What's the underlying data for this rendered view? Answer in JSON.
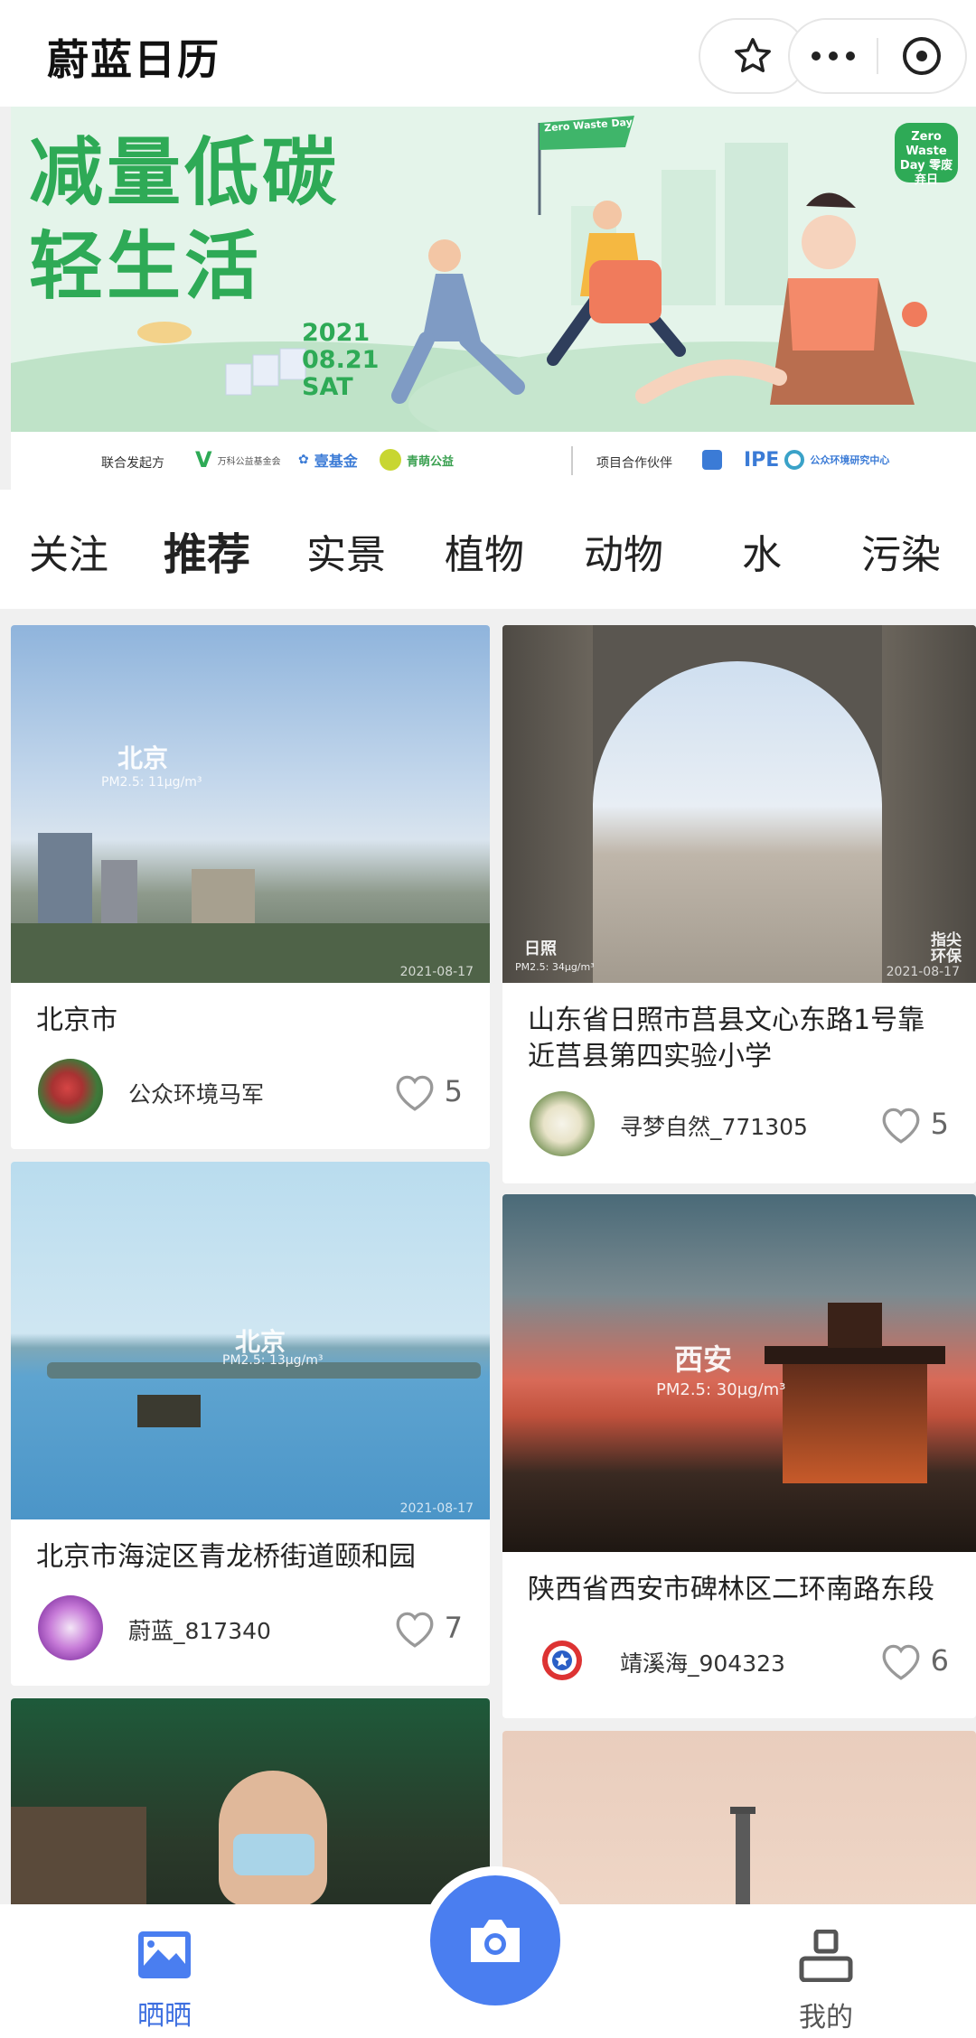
{
  "app": {
    "title": "蔚蓝日历"
  },
  "banner": {
    "title_line1": "减量低碳",
    "title_line2": "轻生活",
    "date_year": "2021",
    "date_md": "08.21",
    "date_day": "SAT",
    "zero_badge": "Zero Waste Day 零废弃日",
    "flag_text": "Zero Waste Day",
    "co_initiators_label": "联合发起方",
    "partner_1": "万科公益基金会",
    "partner_2": "壹基金",
    "partner_3": "青萌公益",
    "project_partner_label": "项目合作伙伴",
    "partner_4": "IPE",
    "partner_5": "公众环境研究中心"
  },
  "tabs": [
    "关注",
    "推荐",
    "实景",
    "植物",
    "动物",
    "水",
    "污染"
  ],
  "active_tab": "推荐",
  "cards": [
    {
      "place": "北京市",
      "user": "公众环境马军",
      "likes": "5",
      "city_overlay": "北京",
      "pm": "PM2.5: 11μg/m³",
      "photo_date": "2021-08-17"
    },
    {
      "place": "山东省日照市莒县文心东路1号靠近莒县第四实验小学",
      "user": "寻梦自然_771305",
      "likes": "5",
      "city_overlay": "日照",
      "pm": "PM2.5: 34μg/m³",
      "photo_date": "2021-08-17",
      "corner_text": "指尖环保"
    },
    {
      "place": "北京市海淀区青龙桥街道颐和园",
      "user": "蔚蓝_817340",
      "likes": "7",
      "city_overlay": "北京",
      "pm": "PM2.5: 13μg/m³",
      "photo_date": "2021-08-17"
    },
    {
      "place": "陕西省西安市碑林区二环南路东段",
      "user": "靖溪海_904323",
      "likes": "6",
      "city_overlay": "西安",
      "pm": "PM2.5:  30μg/m³"
    }
  ],
  "nav": {
    "left": "晒晒",
    "right": "我的"
  },
  "colors": {
    "accent": "#4a7ef0",
    "banner_green": "#2eaa56",
    "heart": "#999999"
  },
  "icons": [
    "star-icon",
    "more-icon",
    "close-icon",
    "heart-icon",
    "camera-icon",
    "gallery-icon",
    "profile-icon"
  ]
}
